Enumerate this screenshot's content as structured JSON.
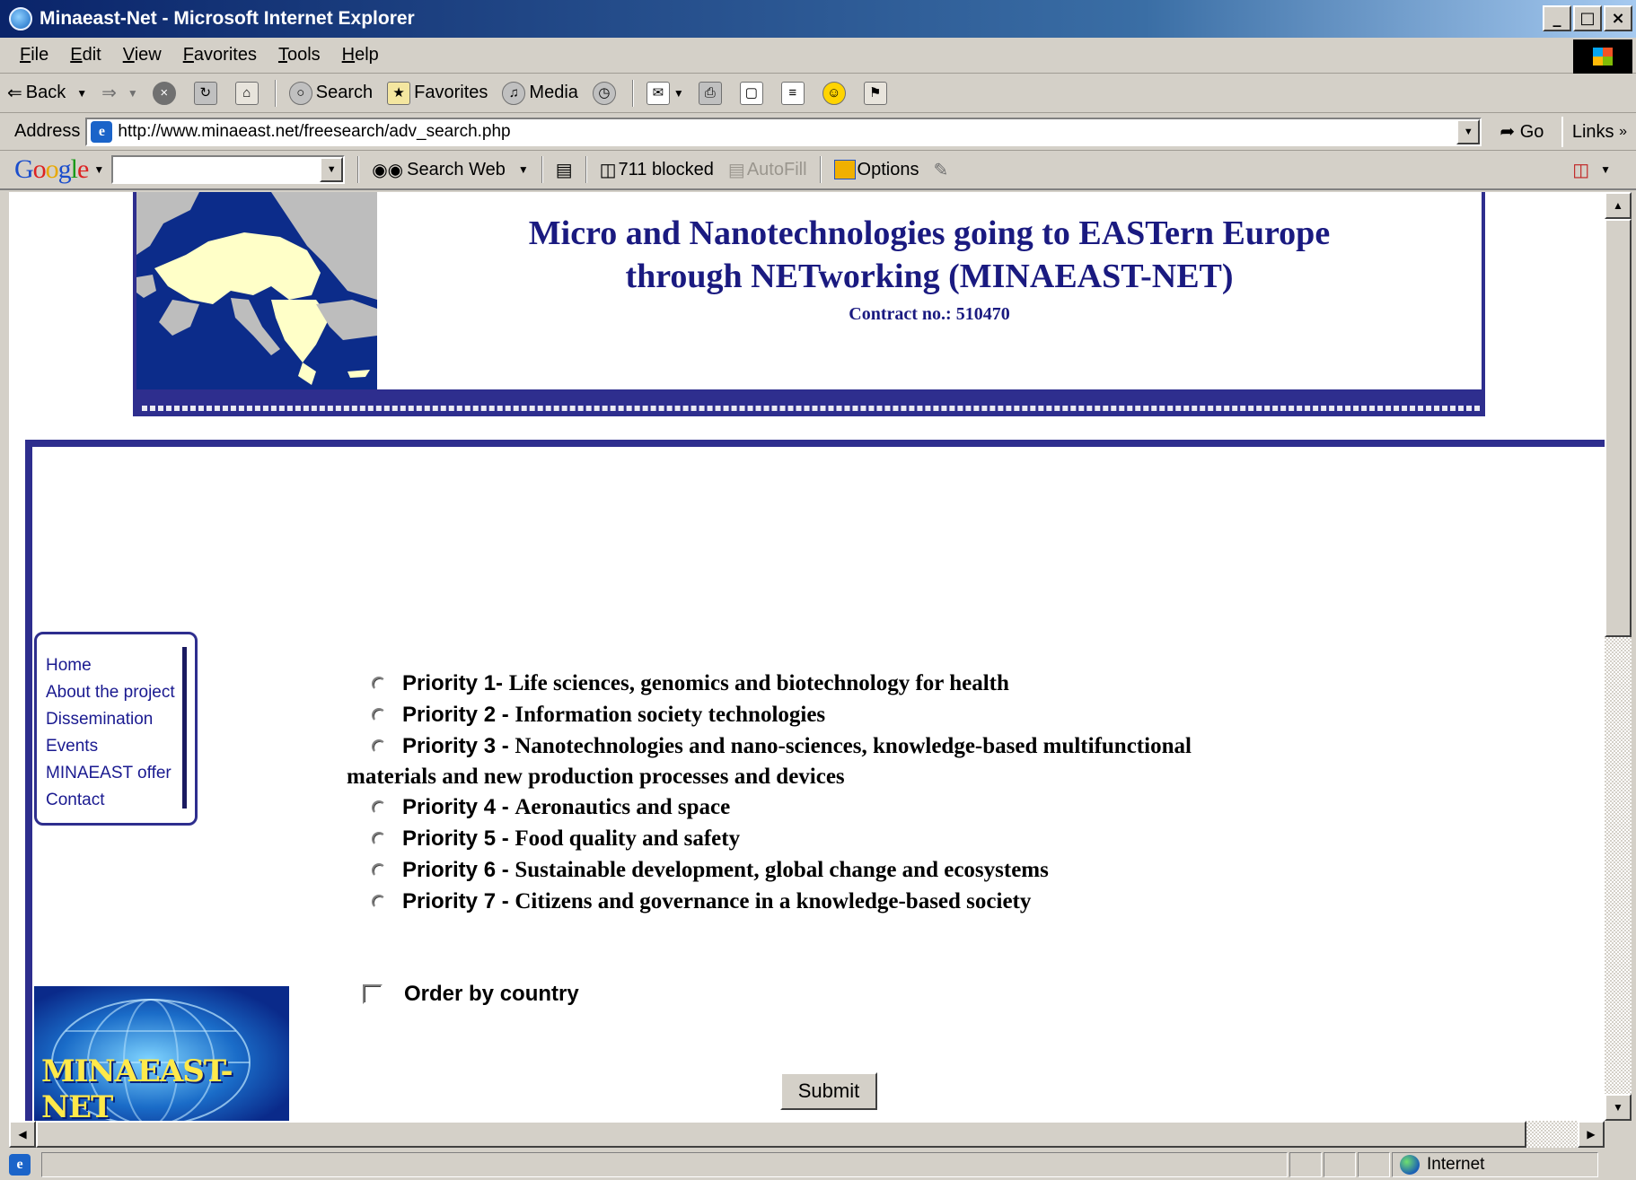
{
  "window": {
    "title": "Minaeast-Net - Microsoft Internet Explorer",
    "controls": [
      "_",
      "□",
      "×"
    ]
  },
  "menu": [
    "File",
    "Edit",
    "View",
    "Favorites",
    "Tools",
    "Help"
  ],
  "toolbar": {
    "back": "Back",
    "search": "Search",
    "favorites": "Favorites",
    "media": "Media"
  },
  "address": {
    "label": "Address",
    "url": "http://www.minaeast.net/freesearch/adv_search.php",
    "go": "Go",
    "links": "Links"
  },
  "google_toolbar": {
    "logo": [
      "G",
      "o",
      "o",
      "g",
      "l",
      "e"
    ],
    "search_web": "Search Web",
    "blocked": "711 blocked",
    "autofill": "AutoFill",
    "options": "Options"
  },
  "page": {
    "banner": {
      "title_line1": "Micro and Nanotechnologies going to EASTern Europe",
      "title_line2": "through NETworking (MINAEAST-NET)",
      "contract": "Contract no.: 510470"
    },
    "nav": [
      "Home",
      "About the project",
      "Dissemination",
      "Events",
      "MINAEAST offer",
      "Contact"
    ],
    "priorities": [
      {
        "label": "Priority 1",
        "sep": "- ",
        "desc": "Life sciences, genomics and biotechnology for health"
      },
      {
        "label": "Priority 2",
        "sep": " - ",
        "desc": "Information society technologies"
      },
      {
        "label": "Priority 3",
        "sep": " - ",
        "desc": "Nanotechnologies and nano-sciences, knowledge-based multifunctional",
        "wrap": "materials and new production processes and devices"
      },
      {
        "label": "Priority 4",
        "sep": " - ",
        "desc": "Aeronautics and space"
      },
      {
        "label": "Priority 5",
        "sep": " - ",
        "desc": "Food quality and safety"
      },
      {
        "label": "Priority 6",
        "sep": " - ",
        "desc": "Sustainable development, global change and ecosystems"
      },
      {
        "label": "Priority 7",
        "sep": " - ",
        "desc": "Citizens and governance in a knowledge-based society"
      }
    ],
    "order_label": "Order by country",
    "submit": "Submit",
    "logo_text": "MINAEAST-NET"
  },
  "status": {
    "zone": "Internet"
  },
  "colors": {
    "banner_blue": "#2e2e8e",
    "title_navy": "#1a1a80",
    "titlebar": "#0a246a"
  }
}
